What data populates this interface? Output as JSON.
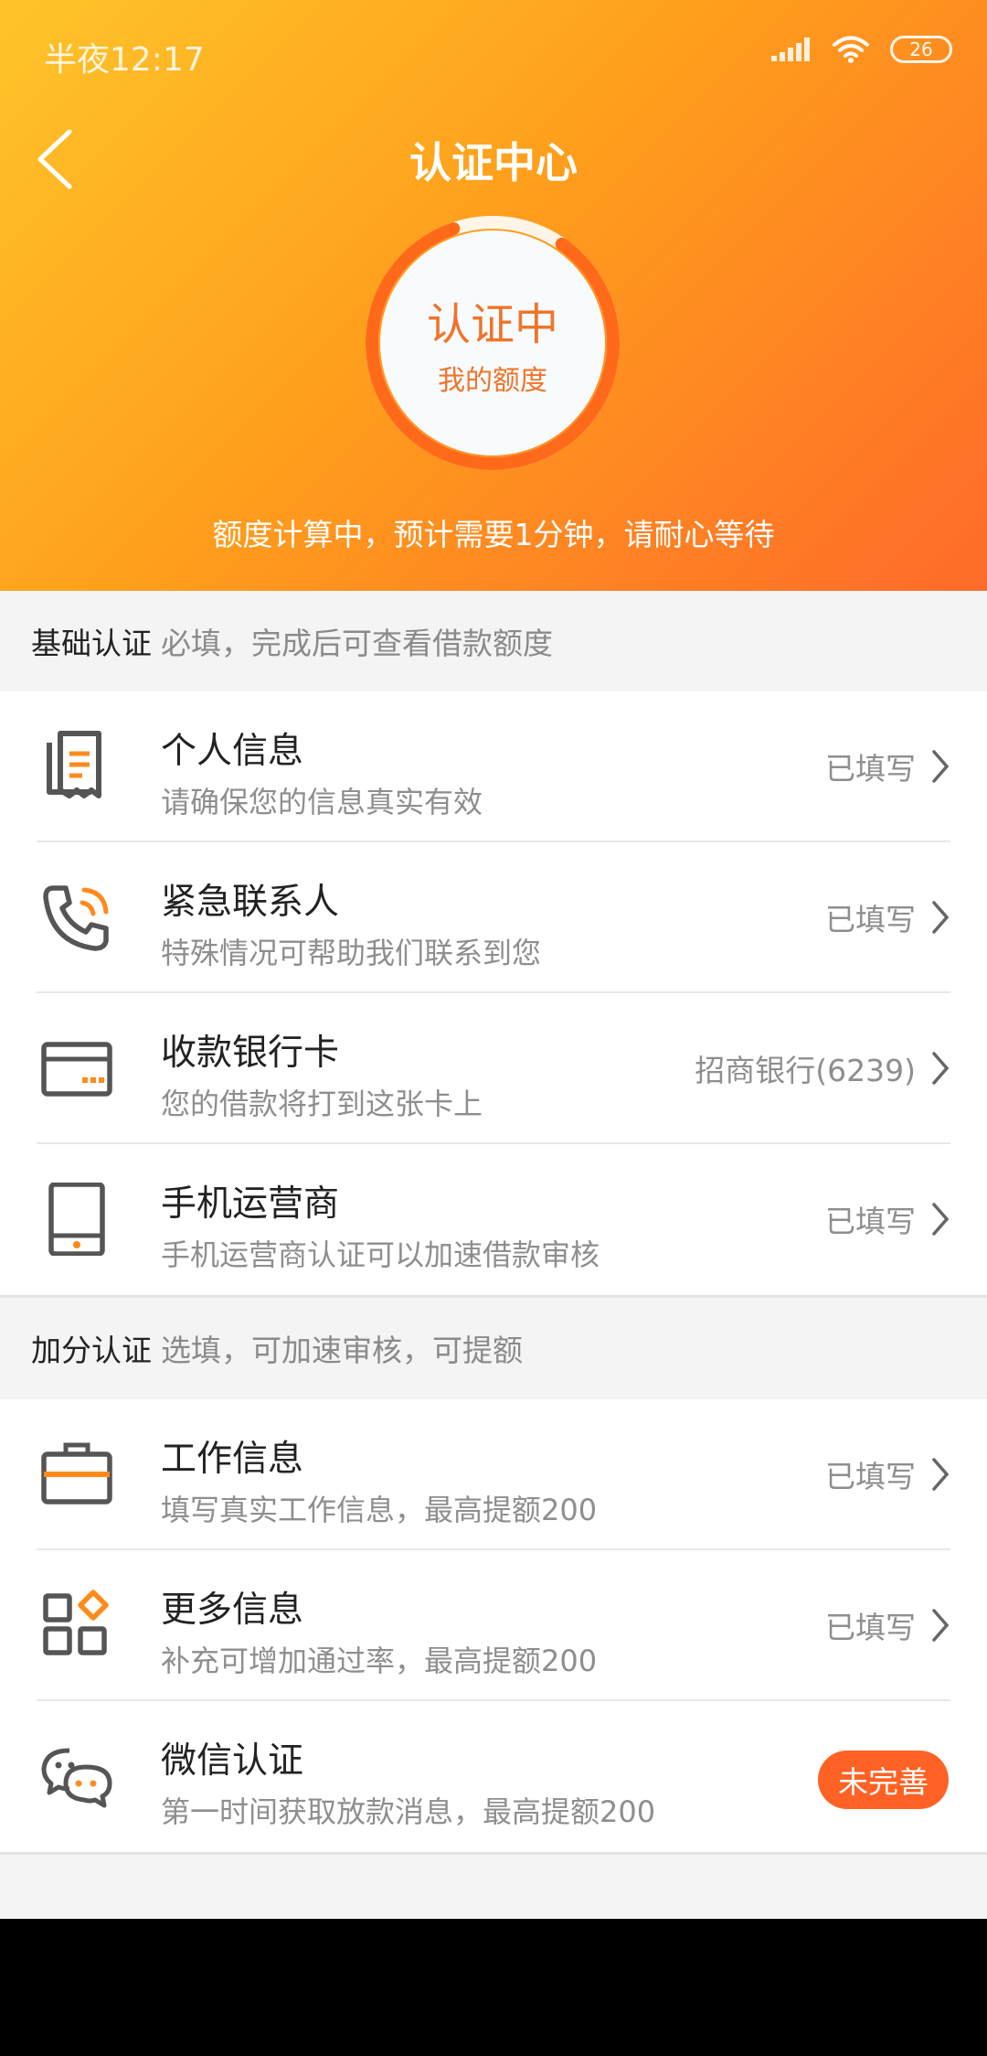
{
  "status_bar": {
    "time": "半夜12:17",
    "battery": "26"
  },
  "header": {
    "title": "认证中心"
  },
  "hero": {
    "ring_status": "认证中",
    "ring_subtitle": "我的额度",
    "note": "额度计算中，预计需要1分钟，请耐心等待"
  },
  "colors": {
    "accent": "#ff6a2a",
    "gradient_start": "#ffc42a",
    "badge": "#ff6224",
    "icon_gray": "#555555",
    "icon_orange": "#ff8a1c"
  },
  "basic": {
    "title": "基础认证",
    "hint": "必填，完成后可查看借款额度",
    "items": [
      {
        "icon": "document-icon",
        "title": "个人信息",
        "desc": "请确保您的信息真实有效",
        "status": "已填写"
      },
      {
        "icon": "phone-icon",
        "title": "紧急联系人",
        "desc": "特殊情况可帮助我们联系到您",
        "status": "已填写"
      },
      {
        "icon": "bank-card-icon",
        "title": "收款银行卡",
        "desc": "您的借款将打到这张卡上",
        "status": "招商银行(6239)"
      },
      {
        "icon": "mobile-device-icon",
        "title": "手机运营商",
        "desc": "手机运营商认证可以加速借款审核",
        "status": "已填写"
      }
    ]
  },
  "bonus": {
    "title": "加分认证",
    "hint": "选填，可加速审核，可提额",
    "items": [
      {
        "icon": "briefcase-icon",
        "title": "工作信息",
        "desc": "填写真实工作信息，最高提额200",
        "status": "已填写"
      },
      {
        "icon": "apps-grid-icon",
        "title": "更多信息",
        "desc": "补充可增加通过率，最高提额200",
        "status": "已填写"
      },
      {
        "icon": "wechat-icon",
        "title": "微信认证",
        "desc": "第一时间获取放款消息，最高提额200",
        "status": "未完善"
      }
    ]
  }
}
